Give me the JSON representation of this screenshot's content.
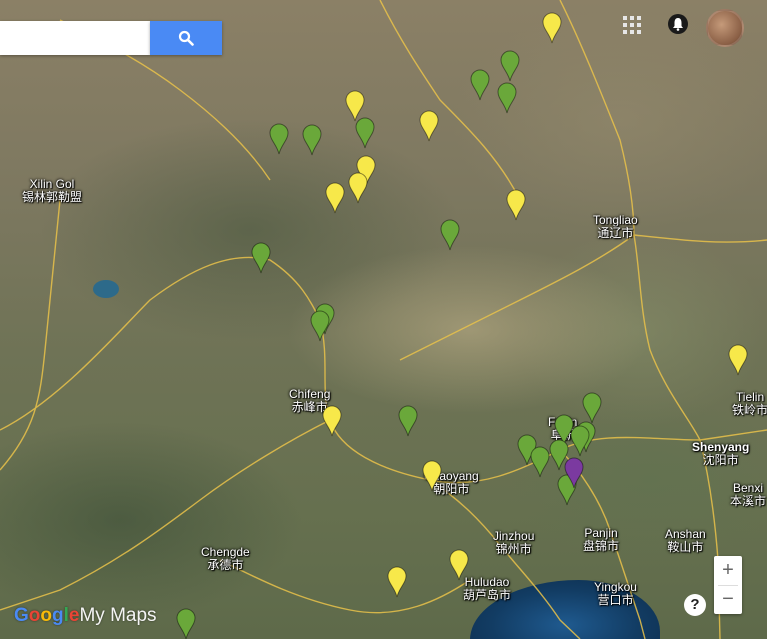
{
  "search": {
    "placeholder": "",
    "value": ""
  },
  "search_button": {
    "icon": "magnifier"
  },
  "top_icons": [
    "grid-icon",
    "location-icon"
  ],
  "zoom": {
    "in_label": "+",
    "out_label": "−"
  },
  "help_label": "?",
  "brand": {
    "google": "Google",
    "product": "My Maps"
  },
  "colors": {
    "yellow_pin": "#f7e84a",
    "green_pin": "#6aa83a",
    "purple_pin": "#7b3aa0",
    "search_button": "#4a8af4"
  },
  "cities": [
    {
      "en": "Xilin Gol",
      "cn": "锡林郭勒盟"
    },
    {
      "en": "Tongliao",
      "cn": "通辽市"
    },
    {
      "en": "Chifeng",
      "cn": "赤峰市"
    },
    {
      "en": "Fuxin",
      "cn": "阜新"
    },
    {
      "en": "Chaoyang",
      "cn": "朝阳市"
    },
    {
      "en": "Tielin",
      "cn": "铁岭市"
    },
    {
      "en": "Shenyang",
      "cn": "沈阳市"
    },
    {
      "en": "Benxi",
      "cn": "本溪市"
    },
    {
      "en": "Jinzhou",
      "cn": "锦州市"
    },
    {
      "en": "Panjin",
      "cn": "盘锦市"
    },
    {
      "en": "Anshan",
      "cn": "鞍山市"
    },
    {
      "en": "Chengde",
      "cn": "承德市"
    },
    {
      "en": "Huludao",
      "cn": "葫芦岛市"
    },
    {
      "en": "Yingkou",
      "cn": "营口市"
    }
  ],
  "markers": [
    {
      "color": "yellow"
    },
    {
      "color": "yellow"
    },
    {
      "color": "yellow"
    },
    {
      "color": "yellow"
    },
    {
      "color": "yellow"
    },
    {
      "color": "yellow"
    },
    {
      "color": "yellow"
    },
    {
      "color": "yellow"
    },
    {
      "color": "yellow"
    },
    {
      "color": "yellow"
    },
    {
      "color": "yellow"
    },
    {
      "color": "yellow"
    },
    {
      "color": "green"
    },
    {
      "color": "green"
    },
    {
      "color": "green"
    },
    {
      "color": "green"
    },
    {
      "color": "green"
    },
    {
      "color": "green"
    },
    {
      "color": "green"
    },
    {
      "color": "green"
    },
    {
      "color": "green"
    },
    {
      "color": "green"
    },
    {
      "color": "green"
    },
    {
      "color": "green"
    },
    {
      "color": "green"
    },
    {
      "color": "green"
    },
    {
      "color": "green"
    },
    {
      "color": "green"
    },
    {
      "color": "green"
    },
    {
      "color": "green"
    },
    {
      "color": "green"
    },
    {
      "color": "green"
    },
    {
      "color": "purple"
    }
  ]
}
